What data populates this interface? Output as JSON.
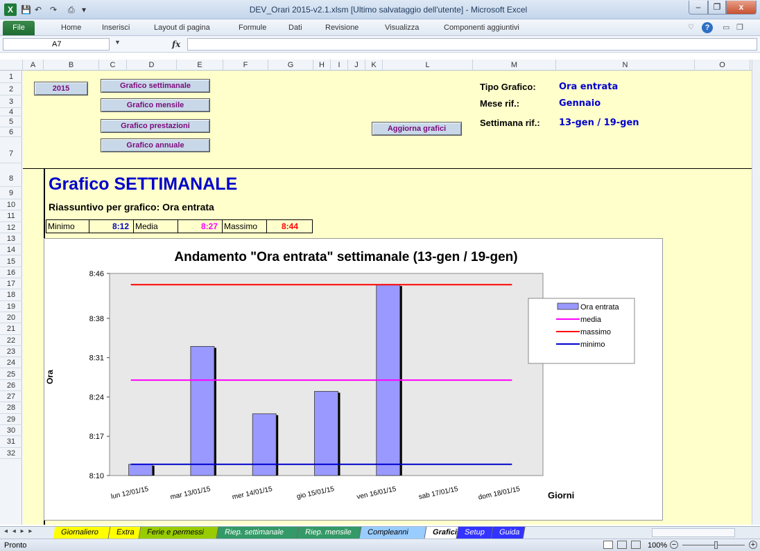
{
  "window": {
    "title": "DEV_Orari 2015-v2.1.xlsm [Ultimo salvataggio dell'utente] - Microsoft Excel",
    "app_icon": "X",
    "minimize": "–",
    "maximize": "❐",
    "close": "x"
  },
  "ribbon": {
    "file": "File",
    "tabs": [
      "Home",
      "Inserisci",
      "Layout di pagina",
      "Formule",
      "Dati",
      "Revisione",
      "Visualizza",
      "Componenti aggiuntivi"
    ]
  },
  "formula_bar": {
    "cell": "A7",
    "fx": "fx",
    "value": ""
  },
  "columns": [
    "A",
    "B",
    "C",
    "D",
    "E",
    "F",
    "G",
    "H",
    "I",
    "J",
    "K",
    "L",
    "M",
    "N",
    "O"
  ],
  "rows": [
    "1",
    "2",
    "3",
    "4",
    "5",
    "6",
    "7",
    "8",
    "9",
    "10",
    "11",
    "12",
    "13",
    "14",
    "15",
    "16",
    "17",
    "18",
    "19",
    "20",
    "21",
    "22",
    "23",
    "24",
    "25",
    "26",
    "27",
    "28",
    "29",
    "30",
    "31",
    "32"
  ],
  "controls": {
    "year": "2015",
    "weekly": "Grafico settimanale",
    "monthly": "Grafico mensile",
    "services": "Grafico prestazioni",
    "annual": "Grafico annuale",
    "update": "Aggiorna grafici"
  },
  "info": {
    "type_label": "Tipo Grafico:",
    "type_value": "Ora entrata",
    "month_label": "Mese rif.:",
    "month_value": "Gennaio",
    "week_label": "Settimana rif.:",
    "week_value": "13-gen / 19-gen"
  },
  "section": {
    "title": "Grafico SETTIMANALE",
    "subtitle": "Riassuntivo per grafico: Ora entrata"
  },
  "stats": {
    "min_label": "Minimo",
    "min_value": "8:12",
    "avg_label": "Media",
    "avg_value": "8:27",
    "max_label": "Massimo",
    "max_value": "8:44"
  },
  "chart_data": {
    "type": "bar",
    "title": "Andamento \"Ora entrata\" settimanale (13-gen / 19-gen)",
    "xlabel": "Giorni",
    "ylabel": "Ora",
    "categories": [
      "lun 12/01/15",
      "mar 13/01/15",
      "mer 14/01/15",
      "gio 15/01/15",
      "ven 16/01/15",
      "sab 17/01/15",
      "dom 18/01/15"
    ],
    "yticks": [
      "8:10",
      "8:17",
      "8:24",
      "8:31",
      "8:38",
      "8:46"
    ],
    "ylim_minutes": [
      490,
      526
    ],
    "series": [
      {
        "name": "Ora entrata",
        "type": "bar",
        "color": "#9999ff",
        "values_minutes": [
          492,
          513,
          501,
          505,
          524,
          null,
          null
        ]
      },
      {
        "name": "media",
        "type": "line",
        "color": "#ff00ff",
        "value_minutes": 507
      },
      {
        "name": "massimo",
        "type": "line",
        "color": "#ff0000",
        "value_minutes": 524
      },
      {
        "name": "minimo",
        "type": "line",
        "color": "#0000cc",
        "value_minutes": 492
      }
    ],
    "legend_position": "right",
    "grid": false
  },
  "sheet_tabs": {
    "nav": "◂ ◂ ▸ ▸",
    "tabs": [
      {
        "label": "Giornaliero",
        "color": "#ffff00"
      },
      {
        "label": "Extra",
        "color": "#ffff00"
      },
      {
        "label": "Ferie e permessi",
        "color": "#99cc00"
      },
      {
        "label": "Riep. settimanale",
        "color": "#339966"
      },
      {
        "label": "Riep. mensile",
        "color": "#339966"
      },
      {
        "label": "Compleanni",
        "color": "#99ccff"
      },
      {
        "label": "Grafici",
        "color": "#ffffff"
      },
      {
        "label": "Setup",
        "color": "#3333ff"
      },
      {
        "label": "Guida",
        "color": "#3333ff"
      }
    ]
  },
  "status": {
    "ready": "Pronto",
    "zoom": "100%"
  }
}
